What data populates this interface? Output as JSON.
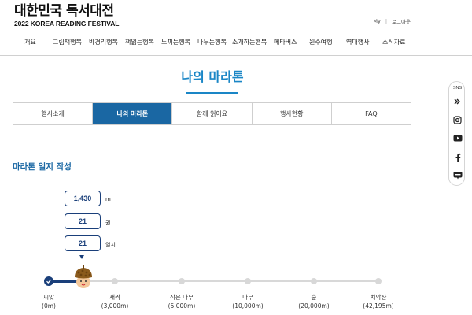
{
  "header": {
    "logo_title": "대한민국 독서대전",
    "logo_sub": "2022 KOREA READING FESTIVAL",
    "util_my": "My",
    "util_sep": "|",
    "util_logout": "로그아웃"
  },
  "gnb": {
    "items": [
      "개요",
      "그림책행복",
      "박경리행복",
      "책읽는행복",
      "느끼는행복",
      "나누는행복",
      "소개하는행복",
      "메타버스",
      "원주여행",
      "역대행사",
      "소식자료"
    ]
  },
  "page": {
    "title": "나의 마라톤"
  },
  "tabs": [
    {
      "label": "행사소개",
      "active": false
    },
    {
      "label": "나의 마라톤",
      "active": true
    },
    {
      "label": "함께 읽어요",
      "active": false
    },
    {
      "label": "행사현황",
      "active": false
    },
    {
      "label": "FAQ",
      "active": false
    }
  ],
  "marathon": {
    "section_title": "마라톤 일지 작성",
    "stats": [
      {
        "value": "1,430",
        "unit": "m"
      },
      {
        "value": "21",
        "unit": "권"
      },
      {
        "value": "21",
        "unit": "일지"
      }
    ],
    "progress_m": 1430,
    "stages": [
      {
        "name": "씨앗",
        "distance": "(0m)"
      },
      {
        "name": "새싹",
        "distance": "(3,000m)"
      },
      {
        "name": "작은 나무",
        "distance": "(5,000m)"
      },
      {
        "name": "나무",
        "distance": "(10,000m)"
      },
      {
        "name": "숲",
        "distance": "(20,000m)"
      },
      {
        "name": "치악산",
        "distance": "(42,195m)"
      }
    ]
  },
  "sns": {
    "title": "SNS",
    "icons": [
      "band-icon",
      "instagram-icon",
      "youtube-icon",
      "facebook-icon",
      "blog-icon"
    ]
  },
  "colors": {
    "accent": "#1a86c6",
    "primary_dark": "#1a3f7a",
    "tab_active": "#1a67a3"
  }
}
